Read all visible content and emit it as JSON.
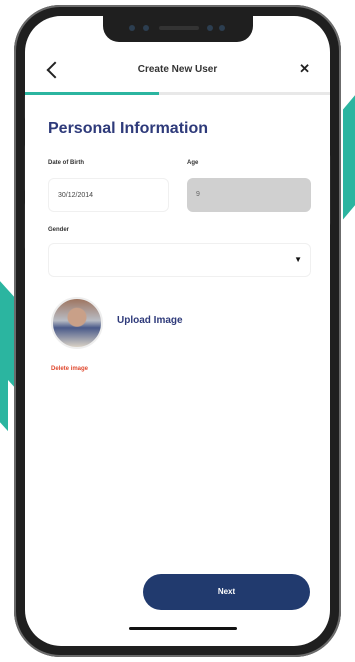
{
  "header": {
    "title": "Create New User",
    "back_icon": "chevron-left-icon",
    "close_label": "✕"
  },
  "progress": {
    "fraction": 0.44,
    "color": "#2bb5a0"
  },
  "section": {
    "title": "Personal Information"
  },
  "fields": {
    "dob": {
      "label": "Date of Birth",
      "value": "30/12/2014"
    },
    "age": {
      "label": "Age",
      "value": "9"
    },
    "gender": {
      "label": "Gender",
      "value": "",
      "dropdown_glyph": "▼"
    }
  },
  "image": {
    "upload_label": "Upload Image",
    "delete_label": "Delete image"
  },
  "actions": {
    "next_label": "Next"
  },
  "colors": {
    "accent": "#2bb5a0",
    "title": "#2e3a7a",
    "button": "#213a6e",
    "danger": "#e0492f"
  }
}
